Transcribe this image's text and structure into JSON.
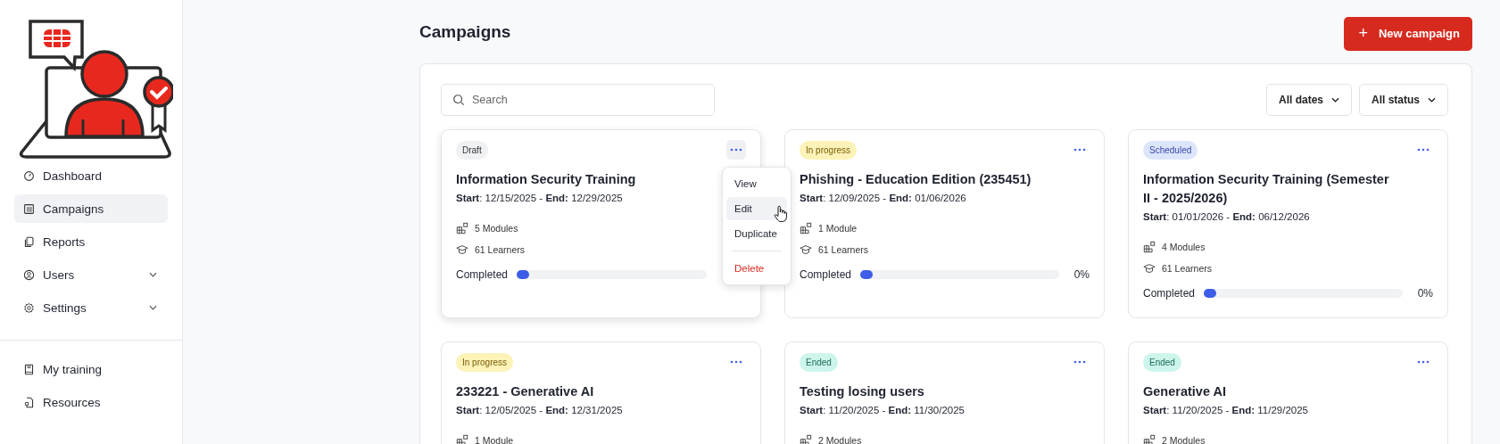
{
  "sidebar": {
    "nav_main": [
      {
        "label": "Dashboard",
        "selected": false,
        "expandable": false
      },
      {
        "label": "Campaigns",
        "selected": true,
        "expandable": false
      },
      {
        "label": "Reports",
        "selected": false,
        "expandable": false
      },
      {
        "label": "Users",
        "selected": false,
        "expandable": true
      },
      {
        "label": "Settings",
        "selected": false,
        "expandable": true
      }
    ],
    "nav_bottom": [
      {
        "label": "My training",
        "selected": false,
        "expandable": false
      },
      {
        "label": "Resources",
        "selected": false,
        "expandable": false
      }
    ]
  },
  "header": {
    "title": "Campaigns",
    "new_button": {
      "icon": "+",
      "label": "New campaign"
    }
  },
  "toolbar": {
    "search": {
      "placeholder": "Search"
    },
    "filters": [
      "All dates",
      "All status"
    ]
  },
  "campaigns": [
    {
      "status": {
        "label": "Draft",
        "kind": "draft"
      },
      "title": "Information Security Training",
      "dates": "**Start**: 12/15/2025 - **End:** 12/29/2025",
      "modules": "5 Modules",
      "learners": "61 Learners",
      "progress_label": "Completed",
      "level": 0,
      "menu_open": true,
      "menu": [
        {
          "label": "View",
          "kind": "normal",
          "selected": false
        },
        {
          "label": "Edit",
          "kind": "normal",
          "selected": true
        },
        {
          "label": "Duplicate",
          "kind": "normal",
          "selected": false
        },
        {
          "label": "Delete",
          "kind": "danger",
          "selected": false
        }
      ]
    },
    {
      "status": {
        "label": "In progress",
        "kind": "in_progress"
      },
      "title": "Phishing - Education Edition (235451)",
      "dates": "**Start**: 12/09/2025 - **End:** 01/06/2026",
      "modules": "1 Module",
      "learners": "61 Learners",
      "progress_label": "Completed",
      "level": 0,
      "percent": "0%",
      "menu_open": false
    },
    {
      "status": {
        "label": "Scheduled",
        "kind": "scheduled"
      },
      "title": "Information Security Training (Semester II - 2025/2026)",
      "dates": "**Start**: 01/01/2026 - **End:** 06/12/2026",
      "modules": "4 Modules",
      "learners": "61 Learners",
      "progress_label": "Completed",
      "level": 0,
      "percent": "0%",
      "menu_open": false
    },
    {
      "status": {
        "label": "In progress",
        "kind": "in_progress"
      },
      "title": "233221 - Generative AI",
      "dates": "**Start**: 12/05/2025 - **End:** 12/31/2025",
      "modules": "1 Module",
      "menu_open": false
    },
    {
      "status": {
        "label": "Ended",
        "kind": "ended"
      },
      "title": "Testing losing users",
      "dates": "**Start**: 11/20/2025 - **End:** 11/30/2025",
      "modules": "2 Modules",
      "menu_open": false
    },
    {
      "status": {
        "label": "Ended",
        "kind": "ended"
      },
      "title": "Generative AI",
      "dates": "**Start**: 11/20/2025 - **End:** 11/29/2025",
      "modules": "2 Modules",
      "menu_open": false
    }
  ]
}
